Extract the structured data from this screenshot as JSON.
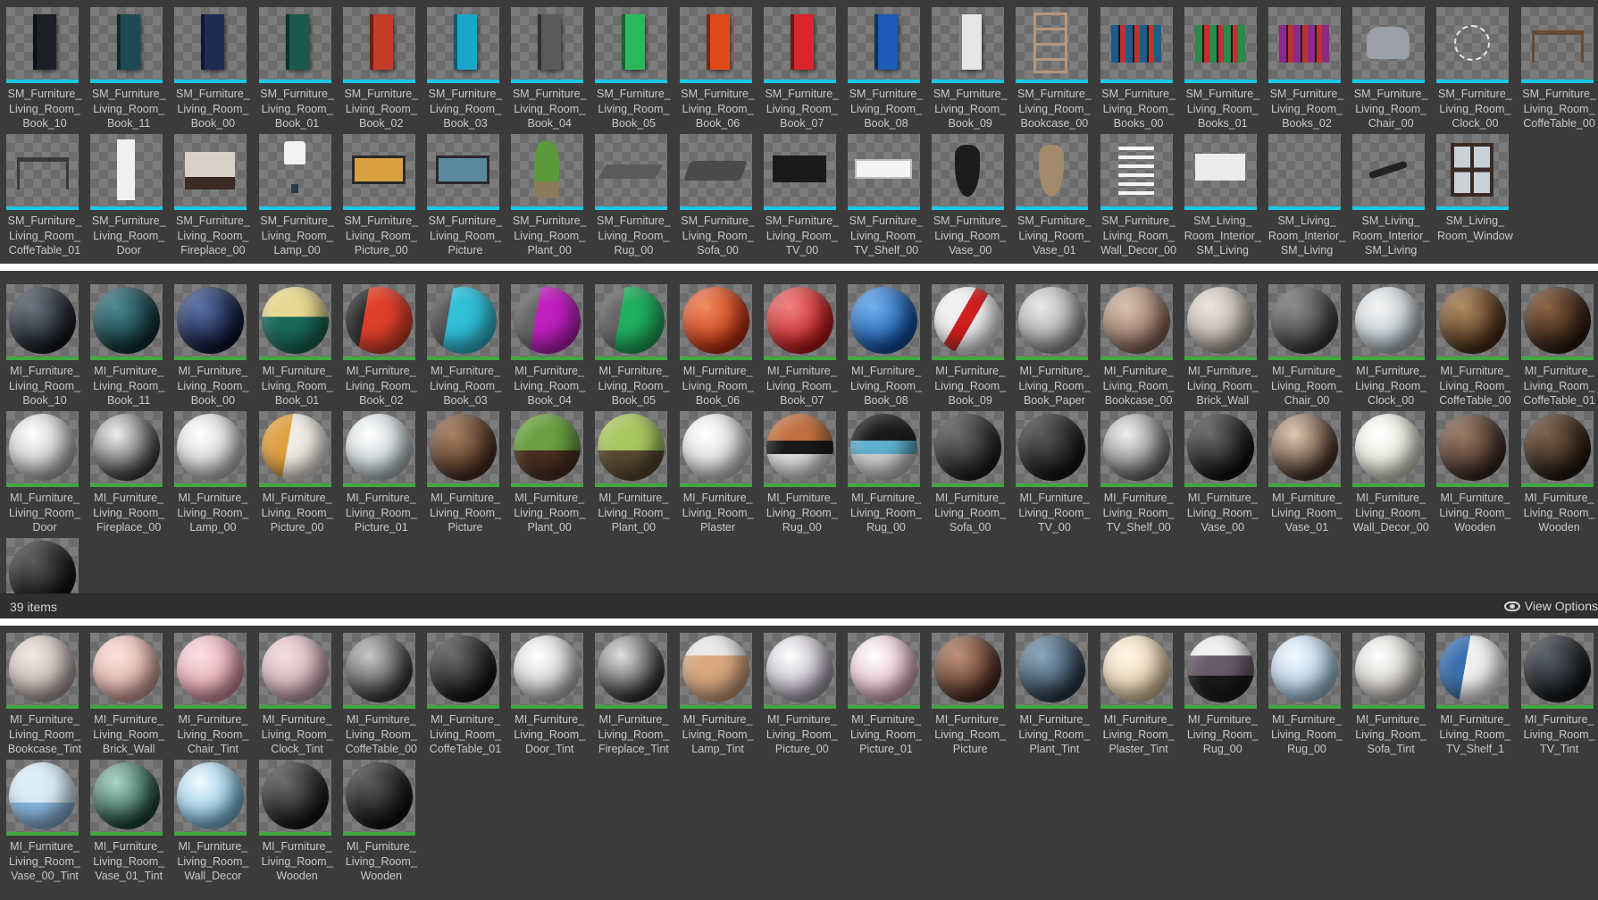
{
  "colors": {
    "mesh_strip": "#19c7e6",
    "material_strip": "#3fa83f"
  },
  "meshes": [
    {
      "label": "SM_Furniture_\nLiving_Room_\nBook_10",
      "shape": "book",
      "color": "#1b1f27"
    },
    {
      "label": "SM_Furniture_\nLiving_Room_\nBook_11",
      "shape": "book",
      "color": "#1b4a52"
    },
    {
      "label": "SM_Furniture_\nLiving_Room_\nBook_00",
      "shape": "book",
      "color": "#1e2c52"
    },
    {
      "label": "SM_Furniture_\nLiving_Room_\nBook_01",
      "shape": "book",
      "color": "#1a5a4c"
    },
    {
      "label": "SM_Furniture_\nLiving_Room_\nBook_02",
      "shape": "book",
      "color": "#c63a28"
    },
    {
      "label": "SM_Furniture_\nLiving_Room_\nBook_03",
      "shape": "book",
      "color": "#1aa6c8"
    },
    {
      "label": "SM_Furniture_\nLiving_Room_\nBook_04",
      "shape": "book",
      "color": "#5a5a5a"
    },
    {
      "label": "SM_Furniture_\nLiving_Room_\nBook_05",
      "shape": "book",
      "color": "#2bb85a"
    },
    {
      "label": "SM_Furniture_\nLiving_Room_\nBook_06",
      "shape": "book",
      "color": "#e04a1a"
    },
    {
      "label": "SM_Furniture_\nLiving_Room_\nBook_07",
      "shape": "book",
      "color": "#d8262a"
    },
    {
      "label": "SM_Furniture_\nLiving_Room_\nBook_08",
      "shape": "book",
      "color": "#1c5cb8"
    },
    {
      "label": "SM_Furniture_\nLiving_Room_\nBook_09",
      "shape": "book",
      "color": "#e6e6e6"
    },
    {
      "label": "SM_Furniture_\nLiving_Room_\nBookcase_00",
      "shape": "bookcase",
      "color": "#b8967a"
    },
    {
      "label": "SM_Furniture_\nLiving_Room_\nBooks_00",
      "shape": "books",
      "color": "#1f5a8a"
    },
    {
      "label": "SM_Furniture_\nLiving_Room_\nBooks_01",
      "shape": "books",
      "color": "#2a8a4a"
    },
    {
      "label": "SM_Furniture_\nLiving_Room_\nBooks_02",
      "shape": "books",
      "color": "#8a2a8a"
    },
    {
      "label": "SM_Furniture_\nLiving_Room_\nChair_00",
      "shape": "chair",
      "color": "#9aa0a6"
    },
    {
      "label": "SM_Furniture_\nLiving_Room_\nClock_00",
      "shape": "clock",
      "color": "#e8e8e8"
    },
    {
      "label": "SM_Furniture_\nLiving_Room_\nCoffeTable_00",
      "shape": "table",
      "color": "#6a4a32"
    },
    {
      "label": "SM_Furniture_\nLiving_Room_\nCoffeTable_01",
      "shape": "table",
      "color": "#3a3a3a"
    },
    {
      "label": "SM_Furniture_\nLiving_Room_\nDoor",
      "shape": "door",
      "color": "#f0f0f0"
    },
    {
      "label": "SM_Furniture_\nLiving_Room_\nFireplace_00",
      "shape": "fireplace",
      "color": "#d8d0c6"
    },
    {
      "label": "SM_Furniture_\nLiving_Room_\nLamp_00",
      "shape": "lamp",
      "color": "#f2f2f2"
    },
    {
      "label": "SM_Furniture_\nLiving_Room_\nPicture_00",
      "shape": "picture",
      "color": "#d8a040"
    },
    {
      "label": "SM_Furniture_\nLiving_Room_\nPicture",
      "shape": "picture",
      "color": "#5a8aa0"
    },
    {
      "label": "SM_Furniture_\nLiving_Room_\nPlant_00",
      "shape": "plant",
      "color": "#5a9a3a"
    },
    {
      "label": "SM_Furniture_\nLiving_Room_\nRug_00",
      "shape": "rug",
      "color": "#5a5a5a"
    },
    {
      "label": "SM_Furniture_\nLiving_Room_\nSofa_00",
      "shape": "sofa",
      "color": "#4a4a4a"
    },
    {
      "label": "SM_Furniture_\nLiving_Room_\nTV_00",
      "shape": "tv",
      "color": "#1a1a1a"
    },
    {
      "label": "SM_Furniture_\nLiving_Room_\nTV_Shelf_00",
      "shape": "shelf",
      "color": "#f4f4f4"
    },
    {
      "label": "SM_Furniture_\nLiving_Room_\nVase_00",
      "shape": "vase",
      "color": "#1c1c1c"
    },
    {
      "label": "SM_Furniture_\nLiving_Room_\nVase_01",
      "shape": "vase",
      "color": "#a08a6a"
    },
    {
      "label": "SM_Furniture_\nLiving_Room_\nWall_Decor_00",
      "shape": "decor",
      "color": "#f4f4f4"
    },
    {
      "label": "SM_Living_\nRoom_Interior_\nSM_Living",
      "shape": "wall",
      "color": "#ececec"
    },
    {
      "label": "SM_Living_\nRoom_Interior_\nSM_Living",
      "shape": "none",
      "color": "#ececec"
    },
    {
      "label": "SM_Living_\nRoom_Interior_\nSM_Living",
      "shape": "remote",
      "color": "#222222"
    },
    {
      "label": "SM_Living_\nRoom_Window",
      "shape": "window",
      "color": "#3a2a22"
    }
  ],
  "materials": [
    {
      "label": "MI_Furniture_\nLiving_Room_\nBook_10",
      "bg": "radial-gradient(circle at 35% 30%, #6a7480, #141820 70%)"
    },
    {
      "label": "MI_Furniture_\nLiving_Room_\nBook_11",
      "bg": "radial-gradient(circle at 35% 30%, #4a8a90, #0e3036 70%)"
    },
    {
      "label": "MI_Furniture_\nLiving_Room_\nBook_00",
      "bg": "radial-gradient(circle at 35% 30%, #5a70a8, #0c1632 70%)"
    },
    {
      "label": "MI_Furniture_\nLiving_Room_\nBook_01",
      "bg": "linear-gradient(180deg, #e6d890 0 45%, #1a6a5a 45%)"
    },
    {
      "label": "MI_Furniture_\nLiving_Room_\nBook_02",
      "bg": "linear-gradient(100deg, #2a2a2a 0 30%, #e0402a 30%)"
    },
    {
      "label": "MI_Furniture_\nLiving_Room_\nBook_03",
      "bg": "linear-gradient(100deg, #555 0 30%, #30c0d8 30%)"
    },
    {
      "label": "MI_Furniture_\nLiving_Room_\nBook_04",
      "bg": "linear-gradient(100deg, #666 0 35%, #c020c0 35%)"
    },
    {
      "label": "MI_Furniture_\nLiving_Room_\nBook_05",
      "bg": "linear-gradient(100deg, #666 0 35%, #20b060 35%)"
    },
    {
      "label": "MI_Furniture_\nLiving_Room_\nBook_06",
      "bg": "radial-gradient(circle at 35% 30%, #f08a5a, #c0300e 70%)"
    },
    {
      "label": "MI_Furniture_\nLiving_Room_\nBook_07",
      "bg": "radial-gradient(circle at 35% 30%, #f08080, #c01818 70%)"
    },
    {
      "label": "MI_Furniture_\nLiving_Room_\nBook_08",
      "bg": "radial-gradient(circle at 35% 30%, #70b0f0, #1050a0 70%)"
    },
    {
      "label": "MI_Furniture_\nLiving_Room_\nBook_09",
      "bg": "linear-gradient(120deg, #f0f0f0 0 40%, #d02020 40% 55%, #f0f0f0 55%)"
    },
    {
      "label": "MI_Furniture_\nLiving_Room_\nBook_Paper",
      "bg": "radial-gradient(circle at 35% 30%, #e8e8e8, #9a9a9a 70%)"
    },
    {
      "label": "MI_Furniture_\nLiving_Room_\nBookcase_00",
      "bg": "radial-gradient(circle at 35% 30%, #d8c0b0, #8a6a5a 70%)"
    },
    {
      "label": "MI_Furniture_\nLiving_Room_\nBrick_Wall",
      "bg": "radial-gradient(circle at 35% 30%, #ece4dc, #b0a89e 70%)"
    },
    {
      "label": "MI_Furniture_\nLiving_Room_\nChair_00",
      "bg": "radial-gradient(circle at 35% 30%, #8a8a8a, #3a3a3a 70%)"
    },
    {
      "label": "MI_Furniture_\nLiving_Room_\nClock_00",
      "bg": "radial-gradient(circle at 35% 30%, #f4f4f4, #b8c4cc 70%)"
    },
    {
      "label": "MI_Furniture_\nLiving_Room_\nCoffeTable_00",
      "bg": "radial-gradient(circle at 35% 30%, #b08a60, #4a2e18 70%)"
    },
    {
      "label": "MI_Furniture_\nLiving_Room_\nCoffeTable_01",
      "bg": "radial-gradient(circle at 35% 30%, #8a6040, #2a1a10 70%)"
    },
    {
      "label": "MI_Furniture_\nLiving_Room_\nDoor",
      "bg": "radial-gradient(circle at 35% 30%, #ffffff, #b8b8b8 70%)"
    },
    {
      "label": "MI_Furniture_\nLiving_Room_\nFireplace_00",
      "bg": "radial-gradient(circle at 35% 30%, #f0f0f0, #3a3a3a 75%)"
    },
    {
      "label": "MI_Furniture_\nLiving_Room_\nLamp_00",
      "bg": "radial-gradient(circle at 35% 30%, #ffffff, #c8c8c8 70%)"
    },
    {
      "label": "MI_Furniture_\nLiving_Room_\nPicture_00",
      "bg": "linear-gradient(100deg, #e0a040 0 40%, #f0ece4 40%)"
    },
    {
      "label": "MI_Furniture_\nLiving_Room_\nPicture_01",
      "bg": "radial-gradient(circle at 35% 30%, #ffffff, #bcc8cc 70%)"
    },
    {
      "label": "MI_Furniture_\nLiving_Room_\nPicture",
      "bg": "radial-gradient(circle at 35% 30%, #a88060, #4a2e20 70%)"
    },
    {
      "label": "MI_Furniture_\nLiving_Room_\nPlant_00",
      "bg": "linear-gradient(180deg, #6aa040 0 55%, #4a3020 55%)"
    },
    {
      "label": "MI_Furniture_\nLiving_Room_\nPlant_00",
      "bg": "linear-gradient(180deg, #a8c860 0 55%, #5a4a30 55%)"
    },
    {
      "label": "MI_Furniture_\nLiving_Room_\nPlaster",
      "bg": "radial-gradient(circle at 35% 30%, #ffffff, #d4d4d4 70%)"
    },
    {
      "label": "MI_Furniture_\nLiving_Room_\nRug_00",
      "bg": "linear-gradient(180deg, #c07040 0 40%, #1a1a1a 40% 60%, #e0e0e0 60%)"
    },
    {
      "label": "MI_Furniture_\nLiving_Room_\nRug_00",
      "bg": "linear-gradient(180deg, #1a1a1a 0 40%, #60b0d0 40% 60%, #d0d0d0 60%)"
    },
    {
      "label": "MI_Furniture_\nLiving_Room_\nSofa_00",
      "bg": "radial-gradient(circle at 35% 30%, #6a6a6a, #1e1e1e 70%)"
    },
    {
      "label": "MI_Furniture_\nLiving_Room_\nTV_00",
      "bg": "radial-gradient(circle at 35% 30%, #5a5a5a, #141414 70%)"
    },
    {
      "label": "MI_Furniture_\nLiving_Room_\nTV_Shelf_00",
      "bg": "radial-gradient(circle at 35% 30%, #f0f0f0, #6a6a6a 75%)"
    },
    {
      "label": "MI_Furniture_\nLiving_Room_\nVase_00",
      "bg": "radial-gradient(circle at 35% 30%, #6a6a6a, #0e0e0e 70%)"
    },
    {
      "label": "MI_Furniture_\nLiving_Room_\nVase_01",
      "bg": "radial-gradient(circle at 35% 30%, #e0c8b0, #4a3428 70%)"
    },
    {
      "label": "MI_Furniture_\nLiving_Room_\nWall_Decor_00",
      "bg": "radial-gradient(circle at 35% 30%, #ffffff, #e0e0d0 70%)"
    },
    {
      "label": "MI_Furniture_\nLiving_Room_\nWooden",
      "bg": "radial-gradient(circle at 35% 30%, #9a7a66, #3a2820 70%)"
    },
    {
      "label": "MI_Furniture_\nLiving_Room_\nWooden",
      "bg": "radial-gradient(circle at 35% 30%, #7a604c, #24180e 70%)"
    },
    {
      "label": "",
      "bg": "radial-gradient(circle at 35% 30%, #5a5a5a, #101010 70%)"
    }
  ],
  "status": {
    "item_count": "39 items",
    "view_options": "View Options"
  },
  "tints": [
    {
      "label": "MI_Furniture_\nLiving_Room_\nBookcase_Tint",
      "bg": "radial-gradient(circle at 35% 30%, #f4e8e4, #b8a8a4 70%)"
    },
    {
      "label": "MI_Furniture_\nLiving_Room_\nBrick_Wall",
      "bg": "radial-gradient(circle at 35% 30%, #fce0d8, #d8a8a0 70%)"
    },
    {
      "label": "MI_Furniture_\nLiving_Room_\nChair_Tint",
      "bg": "radial-gradient(circle at 35% 30%, #fce0e4, #e09aa8 70%)"
    },
    {
      "label": "MI_Furniture_\nLiving_Room_\nClock_Tint",
      "bg": "radial-gradient(circle at 35% 30%, #f4dce0, #c8a8b0 70%)"
    },
    {
      "label": "MI_Furniture_\nLiving_Room_\nCoffeTable_00",
      "bg": "radial-gradient(circle at 35% 30%, #c8c8c8, #3a3a3a 70%)"
    },
    {
      "label": "MI_Furniture_\nLiving_Room_\nCoffeTable_01",
      "bg": "radial-gradient(circle at 35% 30%, #6a6a6a, #121212 70%)"
    },
    {
      "label": "MI_Furniture_\nLiving_Room_\nDoor_Tint",
      "bg": "radial-gradient(circle at 35% 30%, #ffffff, #c4c4c4 70%)"
    },
    {
      "label": "MI_Furniture_\nLiving_Room_\nFireplace_Tint",
      "bg": "radial-gradient(circle at 35% 30%, #e0e0e0, #2a2a2a 75%)"
    },
    {
      "label": "MI_Furniture_\nLiving_Room_\nLamp_Tint",
      "bg": "linear-gradient(180deg, #e8e8e8 0 30%, #d8a880 30%)"
    },
    {
      "label": "MI_Furniture_\nLiving_Room_\nPicture_00",
      "bg": "radial-gradient(circle at 35% 30%, #ffffff, #b0a8b8 70%)"
    },
    {
      "label": "MI_Furniture_\nLiving_Room_\nPicture_01",
      "bg": "radial-gradient(circle at 35% 30%, #ffffff, #e0b0c0 70%)"
    },
    {
      "label": "MI_Furniture_\nLiving_Room_\nPicture",
      "bg": "radial-gradient(circle at 35% 30%, #c09078, #4a2c20 70%)"
    },
    {
      "label": "MI_Furniture_\nLiving_Room_\nPlant_Tint",
      "bg": "radial-gradient(circle at 35% 30%, #8aa8c0, #2a3a4a 70%)"
    },
    {
      "label": "MI_Furniture_\nLiving_Room_\nPlaster_Tint",
      "bg": "radial-gradient(circle at 35% 30%, #fff4e4, #e4cca8 70%)"
    },
    {
      "label": "MI_Furniture_\nLiving_Room_\nRug_00",
      "bg": "linear-gradient(180deg, #f0f0f0 0 30%, #6a5a6a 30% 60%, #1a1a1a 60%)"
    },
    {
      "label": "MI_Furniture_\nLiving_Room_\nRug_00",
      "bg": "radial-gradient(circle at 35% 30%, #f0f8ff, #a8c8e0 70%)"
    },
    {
      "label": "MI_Furniture_\nLiving_Room_\nSofa_Tint",
      "bg": "radial-gradient(circle at 35% 30%, #ffffff, #c8c4bc 70%)"
    },
    {
      "label": "MI_Furniture_\nLiving_Room_\nTV_Shelf_1",
      "bg": "linear-gradient(100deg, #3a70b0 0 40%, #f0f0f0 40%)"
    },
    {
      "label": "MI_Furniture_\nLiving_Room_\nTV_Tint",
      "bg": "radial-gradient(circle at 35% 30%, #5a6068, #101418 70%)"
    },
    {
      "label": "MI_Furniture_\nLiving_Room_\nVase_00_Tint",
      "bg": "linear-gradient(180deg, #d8ecf8 0 60%, #8ab8e0 60%)"
    },
    {
      "label": "MI_Furniture_\nLiving_Room_\nVase_01_Tint",
      "bg": "radial-gradient(circle at 35% 30%, #a8d8c8, #1e4838 70%)"
    },
    {
      "label": "MI_Furniture_\nLiving_Room_\nWall_Decor",
      "bg": "radial-gradient(circle at 35% 30%, #f0faff, #80c0e0 70%)"
    },
    {
      "label": "MI_Furniture_\nLiving_Room_\nWooden",
      "bg": "radial-gradient(circle at 35% 30%, #6a6a6a, #141414 70%)"
    },
    {
      "label": "MI_Furniture_\nLiving_Room_\nWooden",
      "bg": "radial-gradient(circle at 35% 30%, #5a5a5a, #101010 70%)"
    }
  ]
}
